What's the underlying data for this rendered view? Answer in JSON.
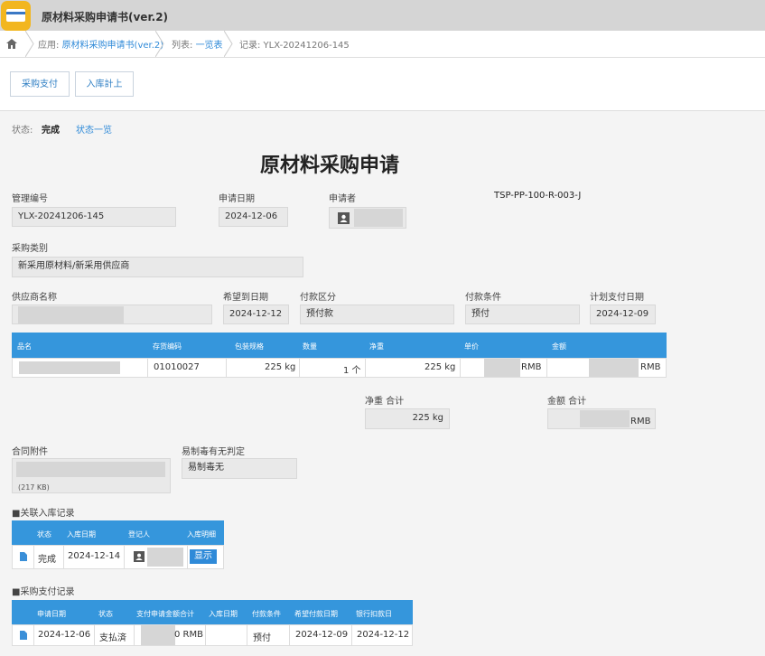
{
  "app": {
    "title": "原材料采购申请书(ver.2)"
  },
  "breadcrumb": {
    "app_label": "应用:",
    "app_link": "原材料采购申请书(ver.2)",
    "list_label": "列表:",
    "list_link": "一览表",
    "record_label": "记录: YLX-20241206-145"
  },
  "toolbar": {
    "btn1": "采购支付",
    "btn2": "入库計上"
  },
  "status": {
    "label": "状态:",
    "value": "完成",
    "link": "状态一览"
  },
  "form": {
    "title": "原材料采购申请",
    "doc_code": "TSP-PP-100-R-003-J",
    "mgmt_no_label": "管理编号",
    "mgmt_no": "YLX-20241206-145",
    "apply_date_label": "申请日期",
    "apply_date": "2024-12-06",
    "applicant_label": "申请者",
    "category_label": "采购类别",
    "category": "新采用原材料/新采用供应商",
    "supplier_label": "供应商名称",
    "hope_date_label": "希望到日期",
    "hope_date": "2024-12-12",
    "pay_type_label": "付款区分",
    "pay_type": "预付款",
    "pay_cond_label": "付款条件",
    "pay_cond": "预付",
    "plan_pay_label": "计划支付日期",
    "plan_pay": "2024-12-09"
  },
  "items_table": {
    "headers": [
      "品名",
      "存货编码",
      "包装规格",
      "数量",
      "净重",
      "单价",
      "金额"
    ],
    "row": {
      "code": "01010027",
      "pack": "225 kg",
      "qty": "1 个",
      "net": "225 kg",
      "price_unit": "RMB",
      "amount_unit": "RMB"
    }
  },
  "totals": {
    "net_label": "净重 合计",
    "net_value": "225 kg",
    "amount_label": "金额 合计",
    "amount_unit": "RMB"
  },
  "attachment": {
    "label": "合同附件",
    "size": "(217 KB)"
  },
  "toxic": {
    "label": "易制毒有无判定",
    "value": "易制毒无"
  },
  "stock_records": {
    "title": "■关联入库记录",
    "headers": [
      "状态",
      "入库日期",
      "登记人",
      "入库明细"
    ],
    "row": {
      "status": "完成",
      "date": "2024-12-14",
      "button": "显示"
    }
  },
  "pay_records": {
    "title": "■采购支付记录",
    "headers": [
      "申请日期",
      "状态",
      "支付申请金额合计",
      "入库日期",
      "付款条件",
      "希望付款日期",
      "银行扣款日"
    ],
    "row": {
      "date": "2024-12-06",
      "status": "支払済",
      "amount_tail": "0 RMB",
      "stock_date": "",
      "cond": "预付",
      "hope": "2024-12-09",
      "bank": "2024-12-12"
    }
  },
  "colors": {
    "accent": "#3596dc",
    "titlebar": "#d5d5d5",
    "app_icon": "#f2b61f"
  },
  "icons": [
    "app-card-icon",
    "home-icon",
    "user-icon",
    "file-icon"
  ]
}
